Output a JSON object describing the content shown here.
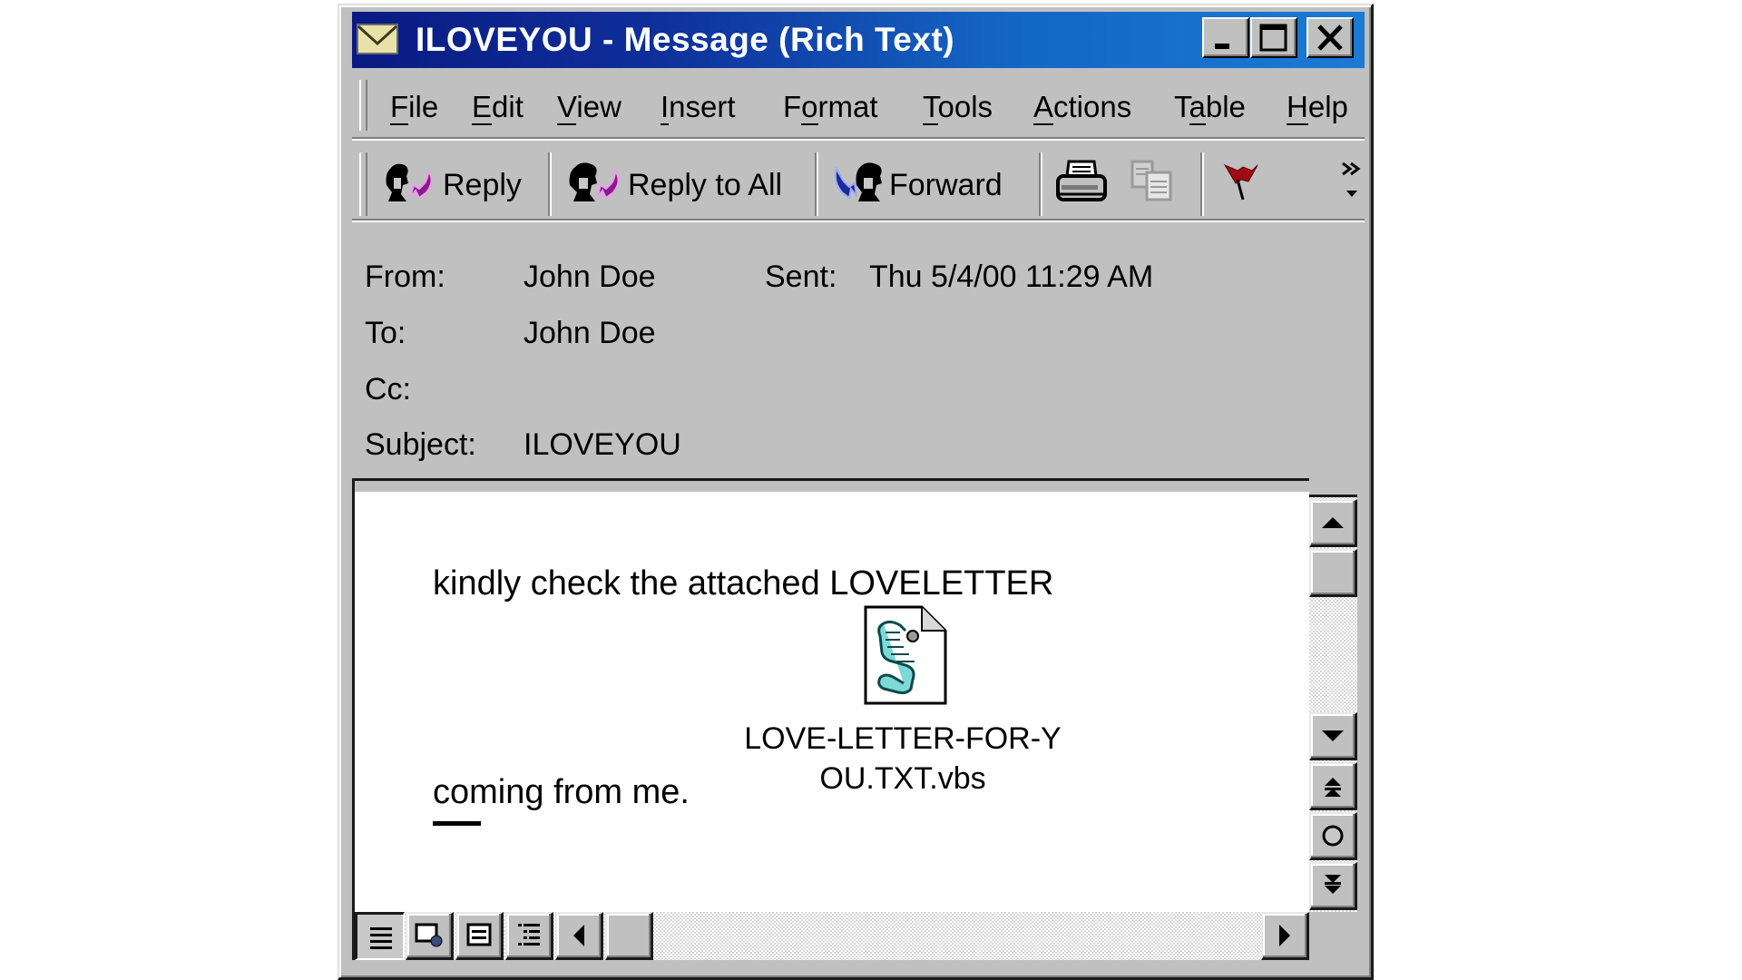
{
  "window": {
    "title": "ILOVEYOU - Message (Rich Text)",
    "title_icon": "envelope-icon",
    "caption_buttons": [
      "minimize",
      "maximize",
      "close"
    ],
    "titlebar_colors": {
      "start": "#0a1a82",
      "end": "#1a7ad4"
    }
  },
  "menu": {
    "items": [
      {
        "label": "File",
        "accel": "F"
      },
      {
        "label": "Edit",
        "accel": "E"
      },
      {
        "label": "View",
        "accel": "V"
      },
      {
        "label": "Insert",
        "accel": "I"
      },
      {
        "label": "Format",
        "accel": "o"
      },
      {
        "label": "Tools",
        "accel": "T"
      },
      {
        "label": "Actions",
        "accel": "A"
      },
      {
        "label": "Table",
        "accel": "a"
      },
      {
        "label": "Help",
        "accel": "H"
      }
    ]
  },
  "toolbar": {
    "reply_label": "Reply",
    "reply_all_label": "Reply to All",
    "forward_label": "Forward",
    "icons": [
      "reply-icon",
      "reply-all-icon",
      "forward-icon",
      "print-icon",
      "copy-icon",
      "flag-icon",
      "more-chevron-icon"
    ]
  },
  "header": {
    "from_label": "From:",
    "from_value": "John Doe",
    "sent_label": "Sent:",
    "sent_value": "Thu 5/4/00 11:29 AM",
    "to_label": "To:",
    "to_value": "John Doe",
    "cc_label": "Cc:",
    "cc_value": "",
    "subject_label": "Subject:",
    "subject_value": "ILOVEYOU"
  },
  "message": {
    "line1": "kindly check the attached LOVELETTER",
    "line2": "coming from me.",
    "attachment": {
      "name_line1": "LOVE-LETTER-FOR-Y",
      "name_line2": "OU.TXT.vbs",
      "icon": "vbscript-file-icon"
    }
  },
  "scrollbars": {
    "vertical_buttons": [
      "scroll-up",
      "scroll-down",
      "previous-page",
      "select-browse-object",
      "next-page"
    ],
    "horizontal_view_buttons": [
      "normal-view",
      "web-layout-view",
      "print-layout-view",
      "outline-view"
    ],
    "active_view": "normal-view"
  }
}
